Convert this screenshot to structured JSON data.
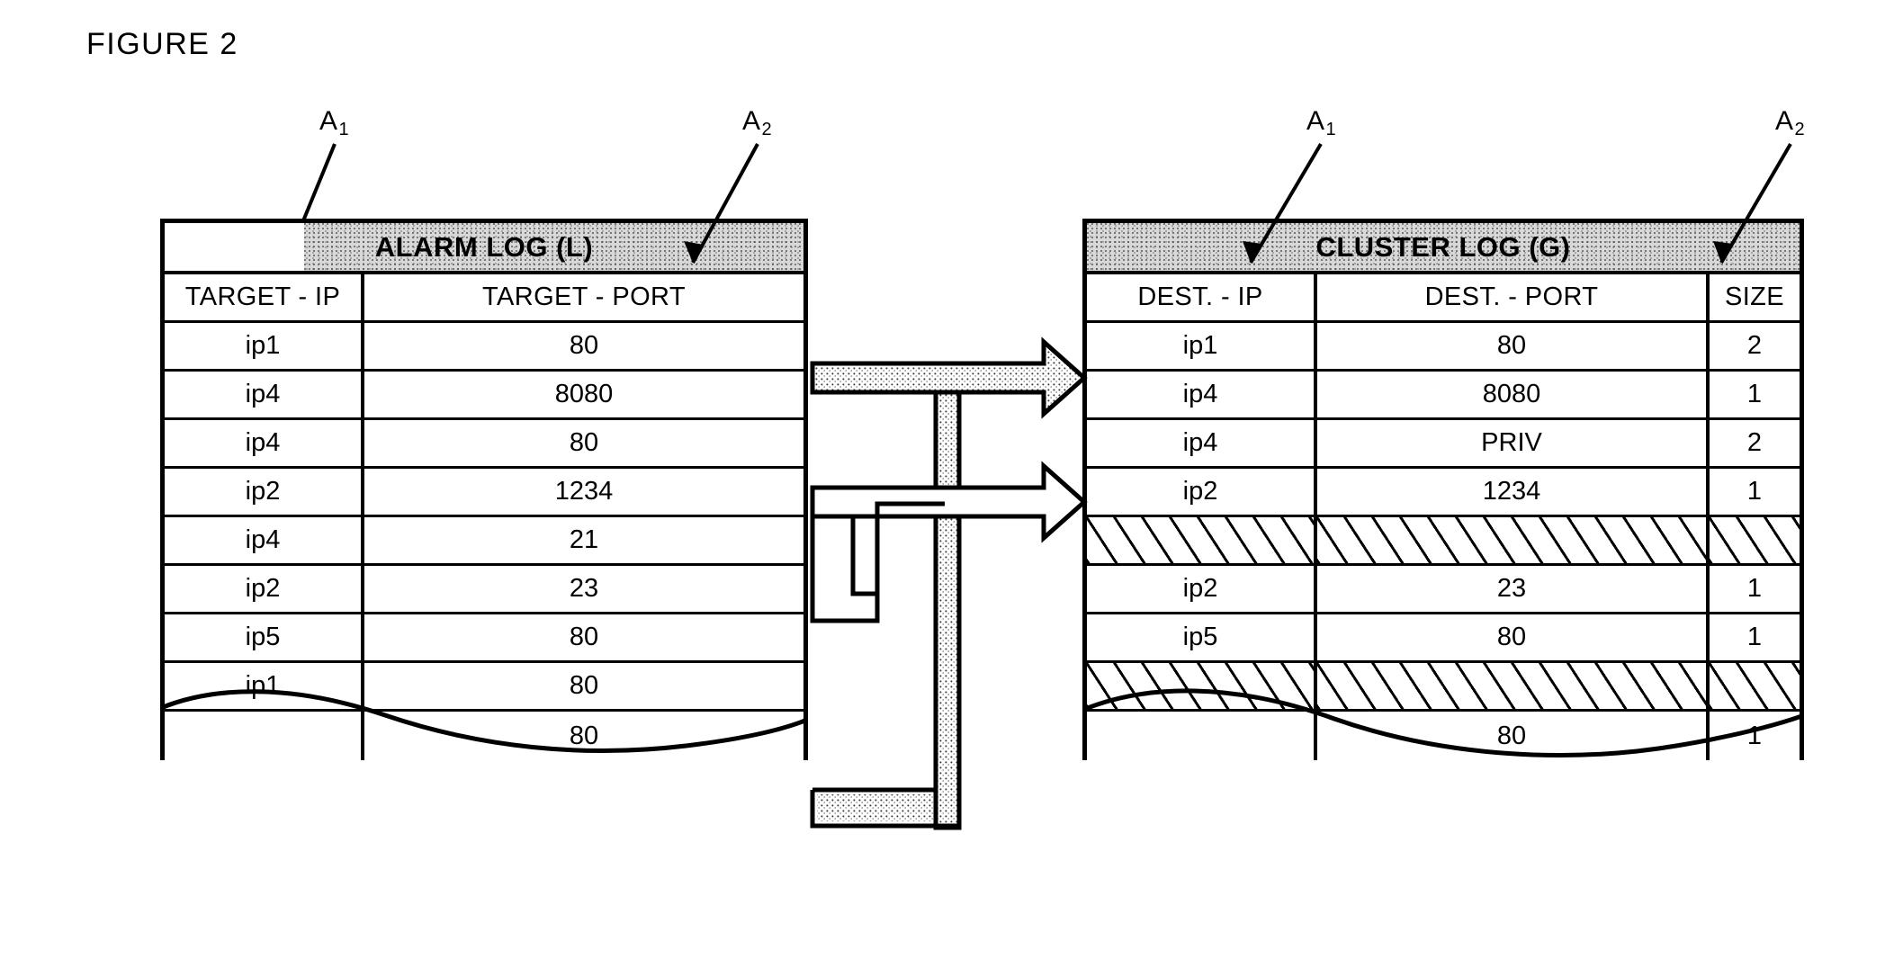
{
  "figure": {
    "title": "FIGURE 2"
  },
  "callouts": {
    "left_first": {
      "label": "A",
      "sub": "1"
    },
    "left_second": {
      "label": "A",
      "sub": "2"
    },
    "right_first": {
      "label": "A",
      "sub": "1"
    },
    "right_second": {
      "label": "A",
      "sub": "2"
    }
  },
  "alarm_log": {
    "title": "ALARM LOG (L)",
    "columns": [
      "TARGET - IP",
      "TARGET - PORT"
    ],
    "rows": [
      {
        "ip": "ip1",
        "port": "80"
      },
      {
        "ip": "ip4",
        "port": "8080"
      },
      {
        "ip": "ip4",
        "port": "80"
      },
      {
        "ip": "ip2",
        "port": "1234"
      },
      {
        "ip": "ip4",
        "port": "21"
      },
      {
        "ip": "ip2",
        "port": "23"
      },
      {
        "ip": "ip5",
        "port": "80"
      },
      {
        "ip": "ip1",
        "port": "80"
      }
    ],
    "partial_row": {
      "ip": "",
      "port": "80"
    }
  },
  "cluster_log": {
    "title": "CLUSTER LOG (G)",
    "columns": [
      "DEST. - IP",
      "DEST. - PORT",
      "SIZE"
    ],
    "rows": [
      {
        "ip": "ip1",
        "port": "80",
        "size": "2",
        "hatched": false
      },
      {
        "ip": "ip4",
        "port": "8080",
        "size": "1",
        "hatched": false
      },
      {
        "ip": "ip4",
        "port": "PRIV",
        "size": "2",
        "hatched": false
      },
      {
        "ip": "ip2",
        "port": "1234",
        "size": "1",
        "hatched": false
      },
      {
        "ip": "",
        "port": "",
        "size": "",
        "hatched": true
      },
      {
        "ip": "ip2",
        "port": "23",
        "size": "1",
        "hatched": false
      },
      {
        "ip": "ip5",
        "port": "80",
        "size": "1",
        "hatched": false
      },
      {
        "ip": "",
        "port": "",
        "size": "",
        "hatched": true
      }
    ],
    "partial_row": {
      "ip": "",
      "port": "80",
      "size": "1"
    }
  },
  "connector": {
    "name": "aggregation-pipe",
    "arrows": 2,
    "description": "hollow pipe routing alarm-log rows into cluster-log rows"
  },
  "colors": {
    "ink": "#000000",
    "paper": "#ffffff",
    "band_fill": "#d8d8d8"
  }
}
